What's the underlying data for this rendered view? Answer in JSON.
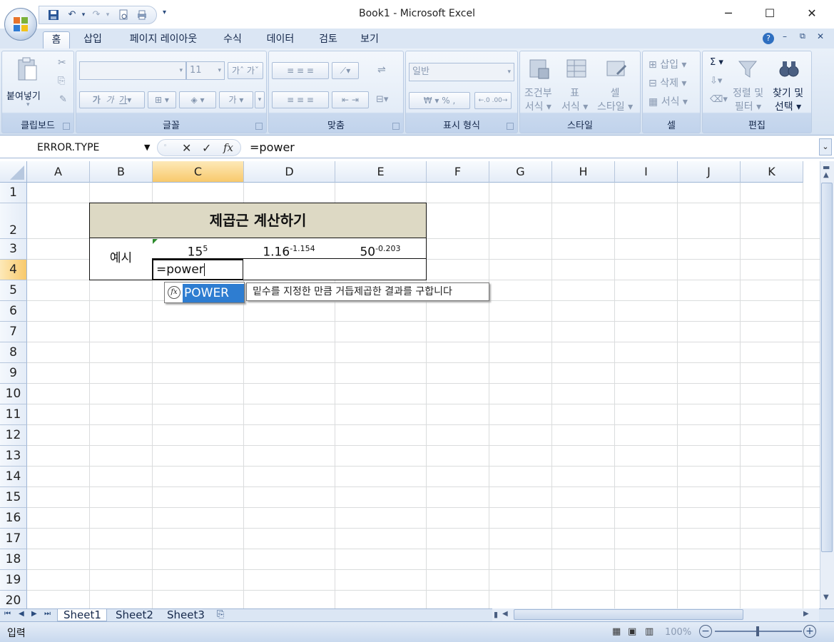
{
  "window": {
    "title": "Book1 - Microsoft Excel",
    "minimize_label": "─",
    "maximize_label": "☐",
    "close_label": "✕"
  },
  "ribbon_tabs": [
    "홈",
    "삽입",
    "페이지 레이아웃",
    "수식",
    "데이터",
    "검토",
    "보기"
  ],
  "ribbon": {
    "clipboard": {
      "paste_label": "붙여넣기",
      "group_label": "클립보드"
    },
    "font": {
      "font_size": "11",
      "group_label": "글꼴",
      "bold": "가",
      "italic": "가",
      "underline": "가",
      "grow": "가",
      "shrink": "가",
      "fill_char": "가"
    },
    "alignment": {
      "group_label": "맞춤"
    },
    "number": {
      "format": "일반",
      "currency": "₩",
      "percent": "%",
      "comma": ",",
      "group_label": "표시 형식"
    },
    "styles": {
      "conditional": "조건부\n서식",
      "conditional1": "조건부",
      "conditional2": "서식",
      "table1": "표",
      "table2": "서식",
      "cell1": "셀",
      "cell2": "스타일",
      "group_label": "스타일"
    },
    "cells": {
      "insert": "삽입",
      "delete": "삭제",
      "format": "서식",
      "group_label": "셀"
    },
    "editing": {
      "sort1": "정렬 및",
      "sort2": "필터",
      "find1": "찾기 및",
      "find2": "선택",
      "sigma": "Σ",
      "group_label": "편집"
    }
  },
  "formula_bar": {
    "name_box": "ERROR.TYPE",
    "formula": "=power",
    "fx_label": "fx"
  },
  "columns": [
    "A",
    "B",
    "C",
    "D",
    "E",
    "F",
    "G",
    "H",
    "I",
    "J",
    "K"
  ],
  "selected_column": "C",
  "rows": [
    "1",
    "2",
    "3",
    "4",
    "5",
    "6",
    "7",
    "8",
    "9",
    "10",
    "11",
    "12",
    "13",
    "14",
    "15",
    "16",
    "17",
    "18",
    "19",
    "20"
  ],
  "selected_row": "4",
  "sheet": {
    "title": "제곱근 계산하기",
    "example_label": "예시",
    "c3_base": "15",
    "c3_exp": "5",
    "d3_base": "1.16",
    "d3_exp": "-1.154",
    "e3_base": "50",
    "e3_exp": "-0.203",
    "c4_editing": "=power",
    "header_fill": "#ddd9c4"
  },
  "autocomplete": {
    "item": "POWER",
    "tooltip": "밑수를 지정한 만큼 거듭제곱한 결과를 구합니다"
  },
  "sheet_tabs": [
    "Sheet1",
    "Sheet2",
    "Sheet3"
  ],
  "status": {
    "mode": "입력",
    "zoom": "100%"
  }
}
